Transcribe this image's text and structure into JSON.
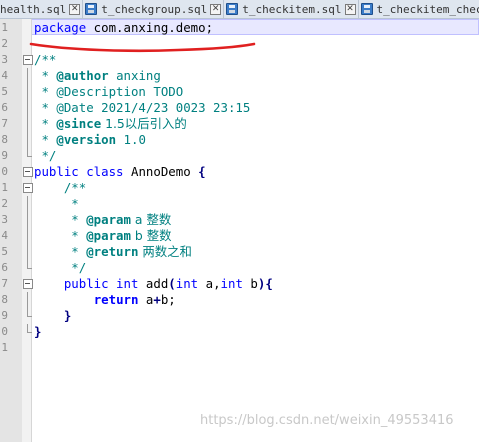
{
  "tabs": [
    {
      "label": "health.sql"
    },
    {
      "label": "t_checkgroup.sql"
    },
    {
      "label": "t_checkitem.sql"
    },
    {
      "label": "t_checkitem_chec"
    }
  ],
  "line_numbers": [
    "1",
    "2",
    "3",
    "4",
    "5",
    "6",
    "7",
    "8",
    "9",
    "0",
    "1",
    "2",
    "3",
    "4",
    "5",
    "6",
    "7",
    "8",
    "9",
    "0",
    "1"
  ],
  "code": {
    "l1_kw": "package",
    "l1_rest": " com.anxing.demo;",
    "l3": "/**",
    "l4_pre": " * ",
    "l4_tag": "@author",
    "l4_rest": " anxing",
    "l5_pre": " * @Description ",
    "l5_todo": "TODO",
    "l6": " * @Date 2021/4/23 0023 23:15",
    "l7_pre": " * ",
    "l7_tag": "@since",
    "l7_rest": " 1.5以后引入的",
    "l8_pre": " * ",
    "l8_tag": "@version",
    "l8_rest": " 1.0",
    "l9": " */",
    "l10_kw": "public class",
    "l10_name": " AnnoDemo ",
    "l10_brace": "{",
    "l11": "    /**",
    "l12": "     *",
    "l13_pre": "     * ",
    "l13_tag": "@param",
    "l13_rest": " a 整数",
    "l14_pre": "     * ",
    "l14_tag": "@param",
    "l14_rest": " b 整数",
    "l15_pre": "     * ",
    "l15_tag": "@return",
    "l15_rest": " 两数之和",
    "l16": "     */",
    "l17_indent": "    ",
    "l17_kw": "public int",
    "l17_name": " add",
    "l17_p1": "(",
    "l17_kw2": "int",
    "l17_a": " a,",
    "l17_kw3": "int",
    "l17_b": " b",
    "l17_p2": "){",
    "l18_indent": "        ",
    "l18_kw": "return",
    "l18_rest": " a",
    "l18_op": "+",
    "l18_end": "b;",
    "l19": "    }",
    "l20": "}"
  },
  "watermark": "https://blog.csdn.net/weixin_49553416",
  "colors": {
    "keyword": "#0000ff",
    "comment": "#008080",
    "annotation_underline": "#e02020"
  }
}
